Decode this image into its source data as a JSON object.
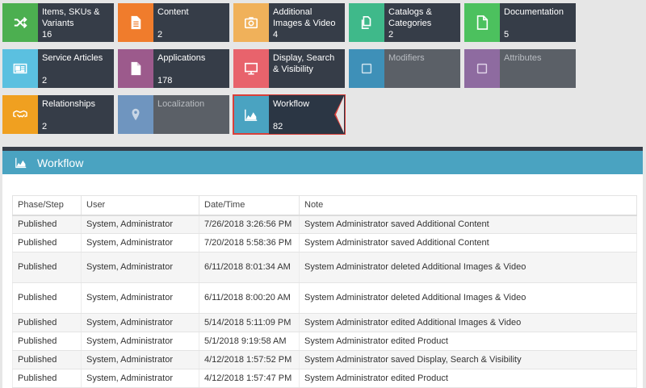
{
  "tiles": [
    {
      "label": "Items, SKUs & Variants",
      "count": "16",
      "color": "#4caf50",
      "icon": "shuffle-icon"
    },
    {
      "label": "Content",
      "count": "2",
      "color": "#f07c2c",
      "icon": "document-icon"
    },
    {
      "label": "Additional Images & Video",
      "count": "4",
      "color": "#f0b15a",
      "icon": "camera-icon"
    },
    {
      "label": "Catalogs & Categories",
      "count": "2",
      "color": "#3fb98a",
      "icon": "copy-icon"
    },
    {
      "label": "Documentation",
      "count": "5",
      "color": "#4cc15e",
      "icon": "file-icon"
    },
    {
      "label": "Service Articles",
      "count": "2",
      "color": "#5bc0e0",
      "icon": "newspaper-icon"
    },
    {
      "label": "Applications",
      "count": "178",
      "color": "#9c5a8c",
      "icon": "document-icon"
    },
    {
      "label": "Display, Search & Visibility",
      "count": "",
      "color": "#e8636c",
      "icon": "monitor-icon"
    },
    {
      "label": "Modifiers",
      "count": "",
      "color": "#3e90b8",
      "icon": "checkbox-icon"
    },
    {
      "label": "Attributes",
      "count": "",
      "color": "#8e6ba0",
      "icon": "checkbox-icon"
    },
    {
      "label": "Relationships",
      "count": "2",
      "color": "#f0a020",
      "icon": "handshake-icon"
    },
    {
      "label": "Localization",
      "count": "",
      "color": "#6f95bf",
      "icon": "map-pin-icon"
    },
    {
      "label": "Workflow",
      "count": "82",
      "color": "#4aa3c1",
      "icon": "area-chart-icon"
    }
  ],
  "panel": {
    "title": "Workflow",
    "icon": "area-chart-icon"
  },
  "table": {
    "headers": [
      "Phase/Step",
      "User",
      "Date/Time",
      "Note"
    ],
    "rows": [
      [
        "Published",
        "System, Administrator",
        "7/26/2018 3:26:56 PM",
        "System Administrator saved Additional Content"
      ],
      [
        "Published",
        "System, Administrator",
        "7/20/2018 5:58:36 PM",
        "System Administrator saved Additional Content"
      ],
      [
        "Published",
        "System, Administrator",
        "6/11/2018 8:01:34 AM",
        "System Administrator deleted Additional Images & Video"
      ],
      [
        "Published",
        "System, Administrator",
        "6/11/2018 8:00:20 AM",
        "System Administrator deleted Additional Images & Video"
      ],
      [
        "Published",
        "System, Administrator",
        "5/14/2018 5:11:09 PM",
        "System Administrator edited Additional Images & Video"
      ],
      [
        "Published",
        "System, Administrator",
        "5/1/2018 9:19:58 AM",
        "System Administrator edited Product"
      ],
      [
        "Published",
        "System, Administrator",
        "4/12/2018 1:57:52 PM",
        "System Administrator saved Display, Search & Visibility"
      ],
      [
        "Published",
        "System, Administrator",
        "4/12/2018 1:57:47 PM",
        "System Administrator edited Product"
      ]
    ]
  }
}
